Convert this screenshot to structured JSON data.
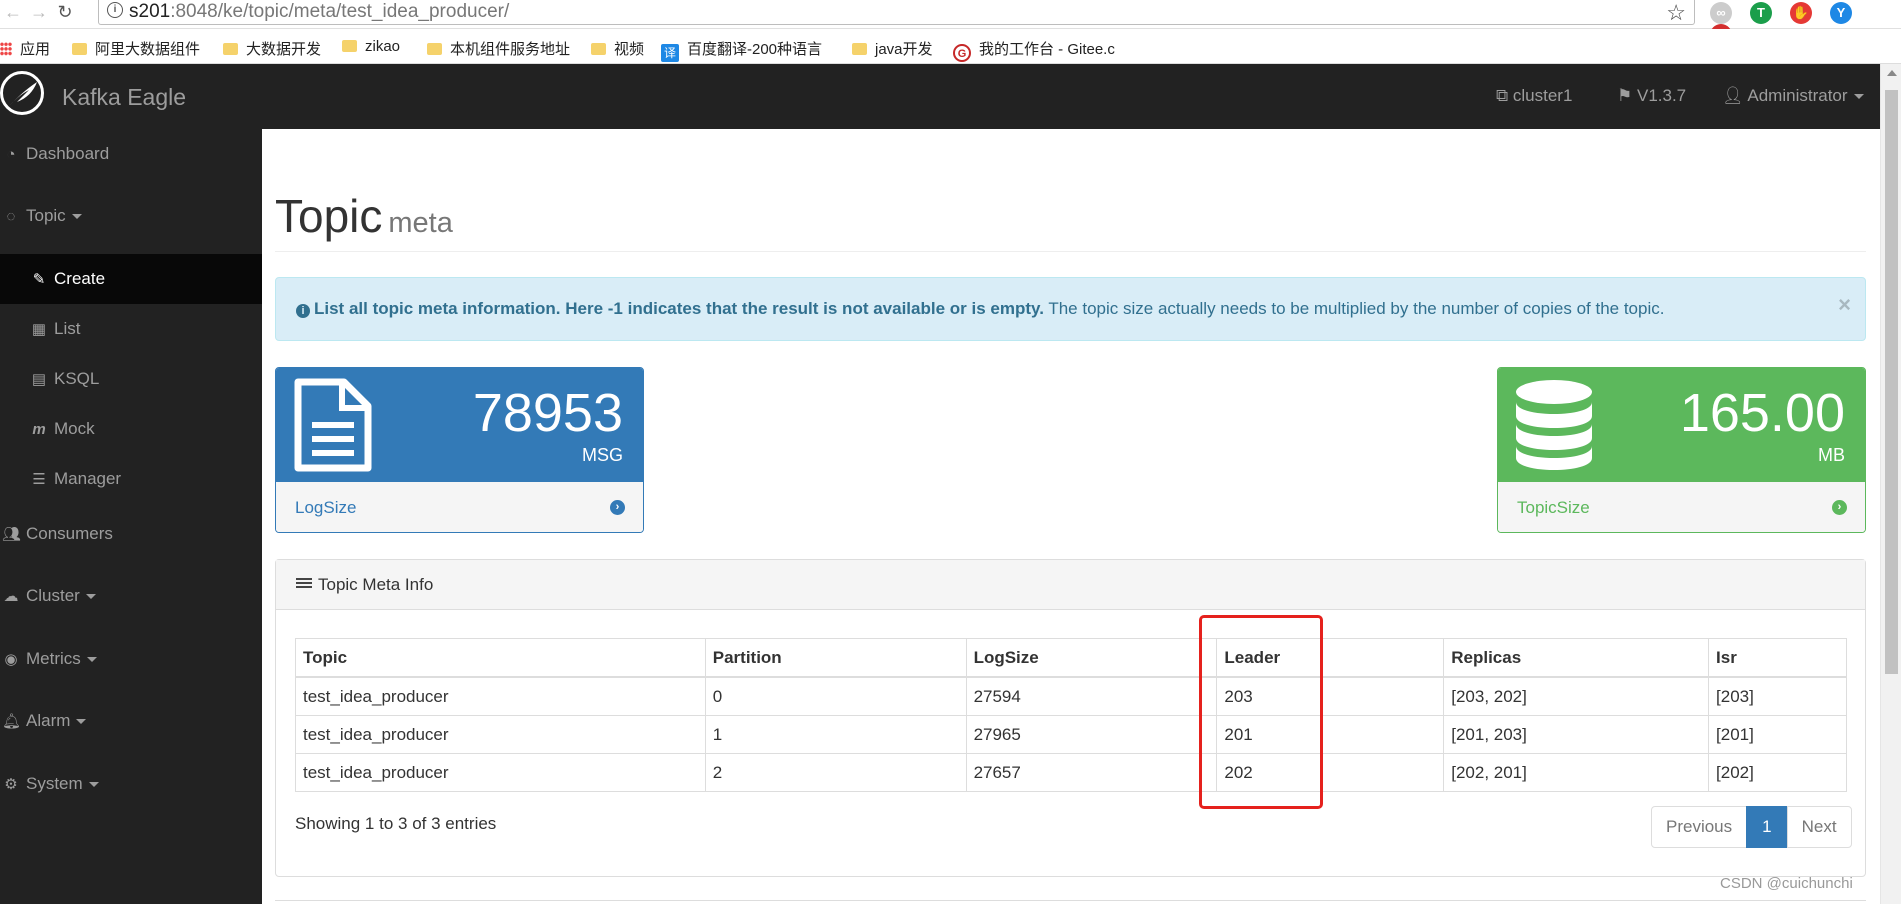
{
  "browser": {
    "url_host": "s201",
    "url_rest": ":8048/ke/topic/meta/test_idea_producer/",
    "bookmarks": [
      {
        "label": "应用",
        "icon": "apps-icon"
      },
      {
        "label": "阿里大数据组件",
        "icon": "folder-icon"
      },
      {
        "label": "大数据开发",
        "icon": "folder-icon"
      },
      {
        "label": "zikao",
        "icon": "folder-icon"
      },
      {
        "label": "本机组件服务地址",
        "icon": "folder-icon"
      },
      {
        "label": "视频",
        "icon": "folder-icon"
      },
      {
        "label": "百度翻译-200种语言",
        "icon": "translate-icon"
      },
      {
        "label": "java开发",
        "icon": "folder-icon"
      },
      {
        "label": "我的工作台 - Gitee.c",
        "icon": "gitee-icon"
      }
    ]
  },
  "header": {
    "brand": "Kafka Eagle",
    "cluster": "cluster1",
    "version": "V1.3.7",
    "user": "Administrator"
  },
  "sidebar": {
    "items": [
      {
        "label": "Dashboard",
        "icon": "dashboard-icon"
      },
      {
        "label": "Topic",
        "icon": "comments-icon"
      },
      {
        "label": "Create",
        "icon": "edit-icon"
      },
      {
        "label": "List",
        "icon": "table-icon"
      },
      {
        "label": "KSQL",
        "icon": "file-icon"
      },
      {
        "label": "Mock",
        "icon": "mock-icon"
      },
      {
        "label": "Manager",
        "icon": "tasks-icon"
      },
      {
        "label": "Consumers",
        "icon": "users-icon"
      },
      {
        "label": "Cluster",
        "icon": "cloud-icon"
      },
      {
        "label": "Metrics",
        "icon": "eye-icon"
      },
      {
        "label": "Alarm",
        "icon": "bell-icon"
      },
      {
        "label": "System",
        "icon": "gear-icon"
      }
    ]
  },
  "page": {
    "title": "Topic",
    "subtitle": "meta",
    "alert_bold": "List all topic meta information. Here -1 indicates that the result is not available or is empty.",
    "alert_text": " The topic size actually needs to be multiplied by the number of copies of the topic.",
    "alert_close": "×"
  },
  "stats": {
    "logsize": {
      "value": "78953",
      "unit": "MSG",
      "label": "LogSize",
      "color": "#337ab7"
    },
    "topicsize": {
      "value": "165.00",
      "unit": "MB",
      "label": "TopicSize",
      "color": "#5cb85c"
    }
  },
  "table": {
    "title": "Topic Meta Info",
    "headers": [
      "Topic",
      "Partition",
      "LogSize",
      "Leader",
      "Replicas",
      "Isr"
    ],
    "rows": [
      [
        "test_idea_producer",
        "0",
        "27594",
        "203",
        "[203, 202]",
        "[203]"
      ],
      [
        "test_idea_producer",
        "1",
        "27965",
        "201",
        "[201, 203]",
        "[201]"
      ],
      [
        "test_idea_producer",
        "2",
        "27657",
        "202",
        "[202, 201]",
        "[202]"
      ]
    ],
    "entries": "Showing 1 to 3 of 3 entries",
    "pager": {
      "prev": "Previous",
      "current": "1",
      "next": "Next"
    }
  },
  "watermark": "CSDN @cuichunchi"
}
